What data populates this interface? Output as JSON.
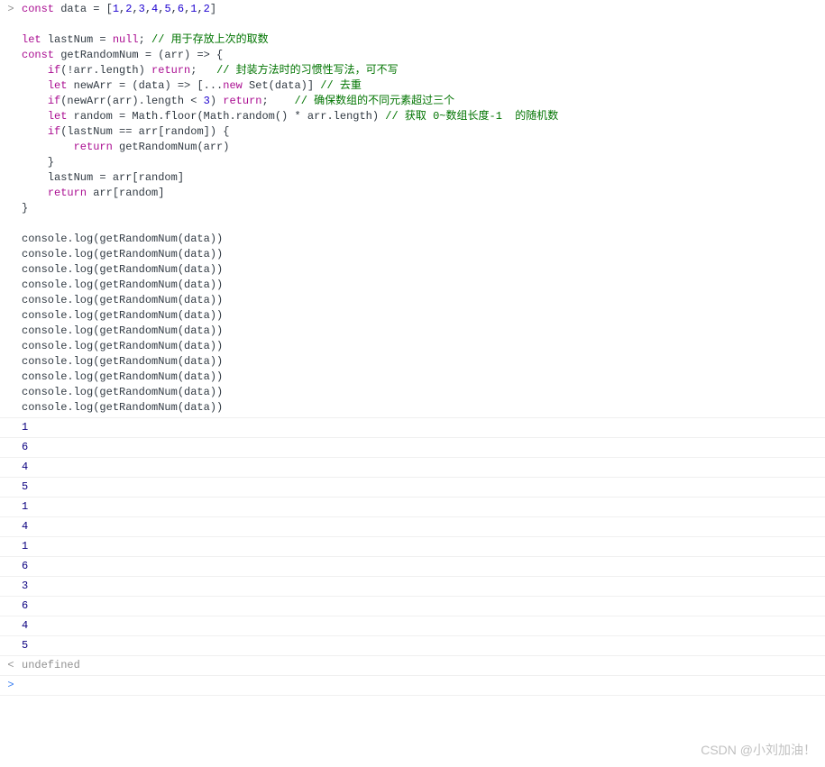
{
  "input_marker": ">",
  "response_marker": "<",
  "code_lines": [
    [
      {
        "t": "kw",
        "v": "const"
      },
      {
        "t": "txt",
        "v": " data = ["
      },
      {
        "t": "str-num",
        "v": "1"
      },
      {
        "t": "txt",
        "v": ","
      },
      {
        "t": "str-num",
        "v": "2"
      },
      {
        "t": "txt",
        "v": ","
      },
      {
        "t": "str-num",
        "v": "3"
      },
      {
        "t": "txt",
        "v": ","
      },
      {
        "t": "str-num",
        "v": "4"
      },
      {
        "t": "txt",
        "v": ","
      },
      {
        "t": "str-num",
        "v": "5"
      },
      {
        "t": "txt",
        "v": ","
      },
      {
        "t": "str-num",
        "v": "6"
      },
      {
        "t": "txt",
        "v": ","
      },
      {
        "t": "str-num",
        "v": "1"
      },
      {
        "t": "txt",
        "v": ","
      },
      {
        "t": "str-num",
        "v": "2"
      },
      {
        "t": "txt",
        "v": "]"
      }
    ],
    [],
    [
      {
        "t": "kw",
        "v": "let"
      },
      {
        "t": "txt",
        "v": " lastNum = "
      },
      {
        "t": "kw",
        "v": "null"
      },
      {
        "t": "txt",
        "v": "; "
      },
      {
        "t": "comment",
        "v": "// 用于存放上次的取数"
      }
    ],
    [
      {
        "t": "kw",
        "v": "const"
      },
      {
        "t": "txt",
        "v": " getRandomNum = (arr) => {"
      }
    ],
    [
      {
        "t": "txt",
        "v": "    "
      },
      {
        "t": "kw",
        "v": "if"
      },
      {
        "t": "txt",
        "v": "(!arr.length) "
      },
      {
        "t": "kw",
        "v": "return"
      },
      {
        "t": "txt",
        "v": ";   "
      },
      {
        "t": "comment",
        "v": "// 封装方法时的习惯性写法，可不写"
      }
    ],
    [
      {
        "t": "txt",
        "v": "    "
      },
      {
        "t": "kw",
        "v": "let"
      },
      {
        "t": "txt",
        "v": " newArr = (data) => [..."
      },
      {
        "t": "kw",
        "v": "new"
      },
      {
        "t": "txt",
        "v": " Set(data)] "
      },
      {
        "t": "comment",
        "v": "// 去重"
      }
    ],
    [
      {
        "t": "txt",
        "v": "    "
      },
      {
        "t": "kw",
        "v": "if"
      },
      {
        "t": "txt",
        "v": "(newArr(arr).length < "
      },
      {
        "t": "str-num",
        "v": "3"
      },
      {
        "t": "txt",
        "v": ") "
      },
      {
        "t": "kw",
        "v": "return"
      },
      {
        "t": "txt",
        "v": ";    "
      },
      {
        "t": "comment",
        "v": "// 确保数组的不同元素超过三个"
      }
    ],
    [
      {
        "t": "txt",
        "v": "    "
      },
      {
        "t": "kw",
        "v": "let"
      },
      {
        "t": "txt",
        "v": " random = Math.floor(Math.random() * arr.length) "
      },
      {
        "t": "comment",
        "v": "// 获取 0~数组长度-1  的随机数"
      }
    ],
    [
      {
        "t": "txt",
        "v": "    "
      },
      {
        "t": "kw",
        "v": "if"
      },
      {
        "t": "txt",
        "v": "(lastNum == arr[random]) {"
      }
    ],
    [
      {
        "t": "txt",
        "v": "        "
      },
      {
        "t": "kw",
        "v": "return"
      },
      {
        "t": "txt",
        "v": " getRandomNum(arr)"
      }
    ],
    [
      {
        "t": "txt",
        "v": "    }"
      }
    ],
    [
      {
        "t": "txt",
        "v": "    lastNum = arr[random]"
      }
    ],
    [
      {
        "t": "txt",
        "v": "    "
      },
      {
        "t": "kw",
        "v": "return"
      },
      {
        "t": "txt",
        "v": " arr[random]"
      }
    ],
    [
      {
        "t": "txt",
        "v": "}"
      }
    ],
    [],
    [
      {
        "t": "txt",
        "v": "console.log(getRandomNum(data))"
      }
    ],
    [
      {
        "t": "txt",
        "v": "console.log(getRandomNum(data))"
      }
    ],
    [
      {
        "t": "txt",
        "v": "console.log(getRandomNum(data))"
      }
    ],
    [
      {
        "t": "txt",
        "v": "console.log(getRandomNum(data))"
      }
    ],
    [
      {
        "t": "txt",
        "v": "console.log(getRandomNum(data))"
      }
    ],
    [
      {
        "t": "txt",
        "v": "console.log(getRandomNum(data))"
      }
    ],
    [
      {
        "t": "txt",
        "v": "console.log(getRandomNum(data))"
      }
    ],
    [
      {
        "t": "txt",
        "v": "console.log(getRandomNum(data))"
      }
    ],
    [
      {
        "t": "txt",
        "v": "console.log(getRandomNum(data))"
      }
    ],
    [
      {
        "t": "txt",
        "v": "console.log(getRandomNum(data))"
      }
    ],
    [
      {
        "t": "txt",
        "v": "console.log(getRandomNum(data))"
      }
    ],
    [
      {
        "t": "txt",
        "v": "console.log(getRandomNum(data))"
      }
    ]
  ],
  "outputs": [
    "1",
    "6",
    "4",
    "5",
    "1",
    "4",
    "1",
    "6",
    "3",
    "6",
    "4",
    "5"
  ],
  "result_value": "undefined",
  "watermark": "CSDN @小刘加油！"
}
